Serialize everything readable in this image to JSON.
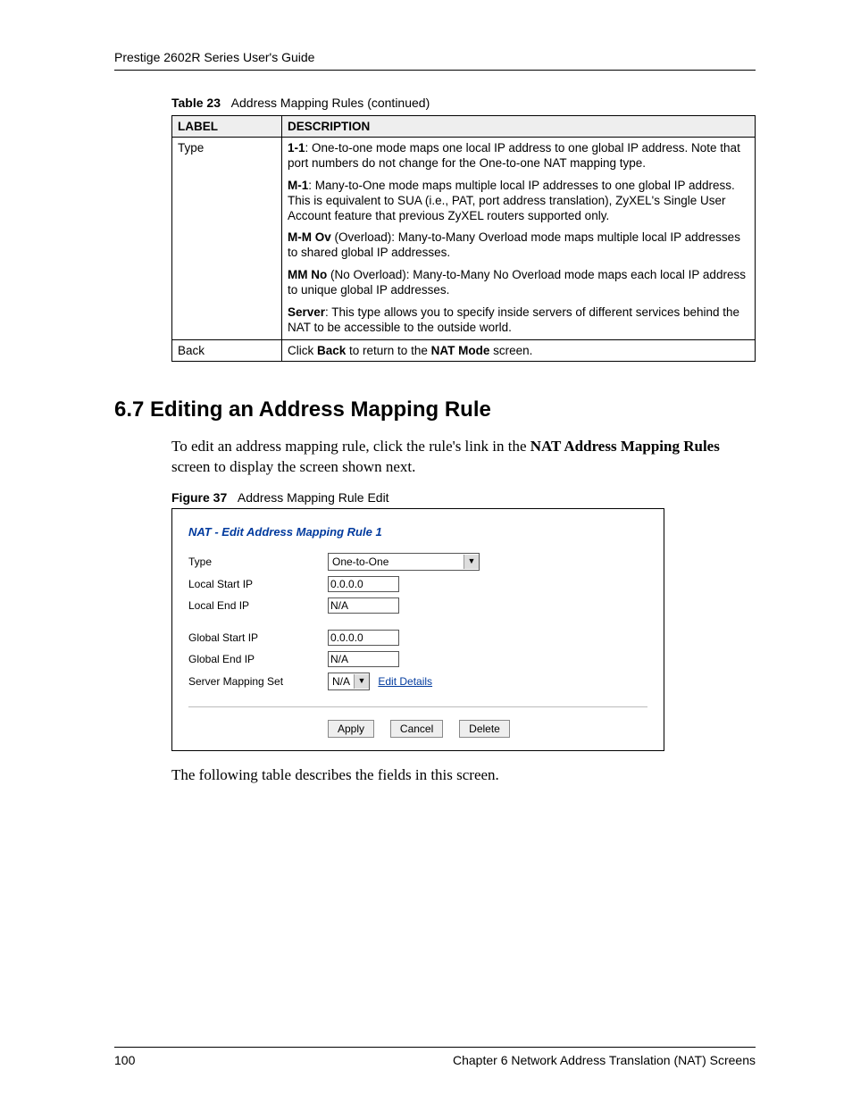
{
  "header": {
    "running_title": "Prestige 2602R Series User's Guide"
  },
  "table23": {
    "caption_bold": "Table 23",
    "caption_rest": "Address Mapping Rules (continued)",
    "headers": {
      "label": "LABEL",
      "description": "DESCRIPTION"
    },
    "rows": [
      {
        "label": "Type",
        "descriptions": [
          {
            "bold": "1-1",
            "text": ": One-to-one mode maps one local IP address to one global IP address. Note that port numbers do not change for the One-to-one NAT mapping type."
          },
          {
            "bold": "M-1",
            "text": ": Many-to-One mode maps multiple local IP addresses to one global IP address. This is equivalent to SUA (i.e., PAT, port address translation), ZyXEL's Single User Account feature that previous ZyXEL routers supported only."
          },
          {
            "bold": "M-M Ov",
            "text": " (Overload): Many-to-Many Overload mode maps multiple local IP addresses to shared global IP addresses."
          },
          {
            "bold": "MM No",
            "text": " (No Overload): Many-to-Many No Overload mode maps each local IP address to unique global IP addresses."
          },
          {
            "bold": "Server",
            "text": ": This type allows you to specify inside servers of different services behind the NAT to be accessible to the outside world."
          }
        ]
      },
      {
        "label": "Back",
        "description_prefix": "Click ",
        "description_bold1": "Back",
        "description_mid": " to return to the ",
        "description_bold2": "NAT Mode",
        "description_suffix": " screen."
      }
    ]
  },
  "section": {
    "number_title": "6.7  Editing an Address Mapping Rule",
    "intro_prefix": "To edit an address mapping rule, click the rule's link in the ",
    "intro_bold": "NAT Address Mapping Rules",
    "intro_suffix": " screen to display the screen shown next.",
    "outro": "The following table describes the fields in this screen."
  },
  "figure37": {
    "caption_bold": "Figure 37",
    "caption_rest": "Address Mapping Rule Edit",
    "panel_title": "NAT - Edit Address Mapping Rule 1",
    "fields": {
      "type_label": "Type",
      "type_value": "One-to-One",
      "local_start_label": "Local Start IP",
      "local_start_value": "0.0.0.0",
      "local_end_label": "Local End IP",
      "local_end_value": "N/A",
      "global_start_label": "Global Start IP",
      "global_start_value": "0.0.0.0",
      "global_end_label": "Global End IP",
      "global_end_value": "N/A",
      "server_set_label": "Server Mapping Set",
      "server_set_value": "N/A",
      "edit_details": "Edit Details"
    },
    "buttons": {
      "apply": "Apply",
      "cancel": "Cancel",
      "delete": "Delete"
    }
  },
  "footer": {
    "page_number": "100",
    "chapter": "Chapter 6 Network Address Translation (NAT) Screens"
  }
}
